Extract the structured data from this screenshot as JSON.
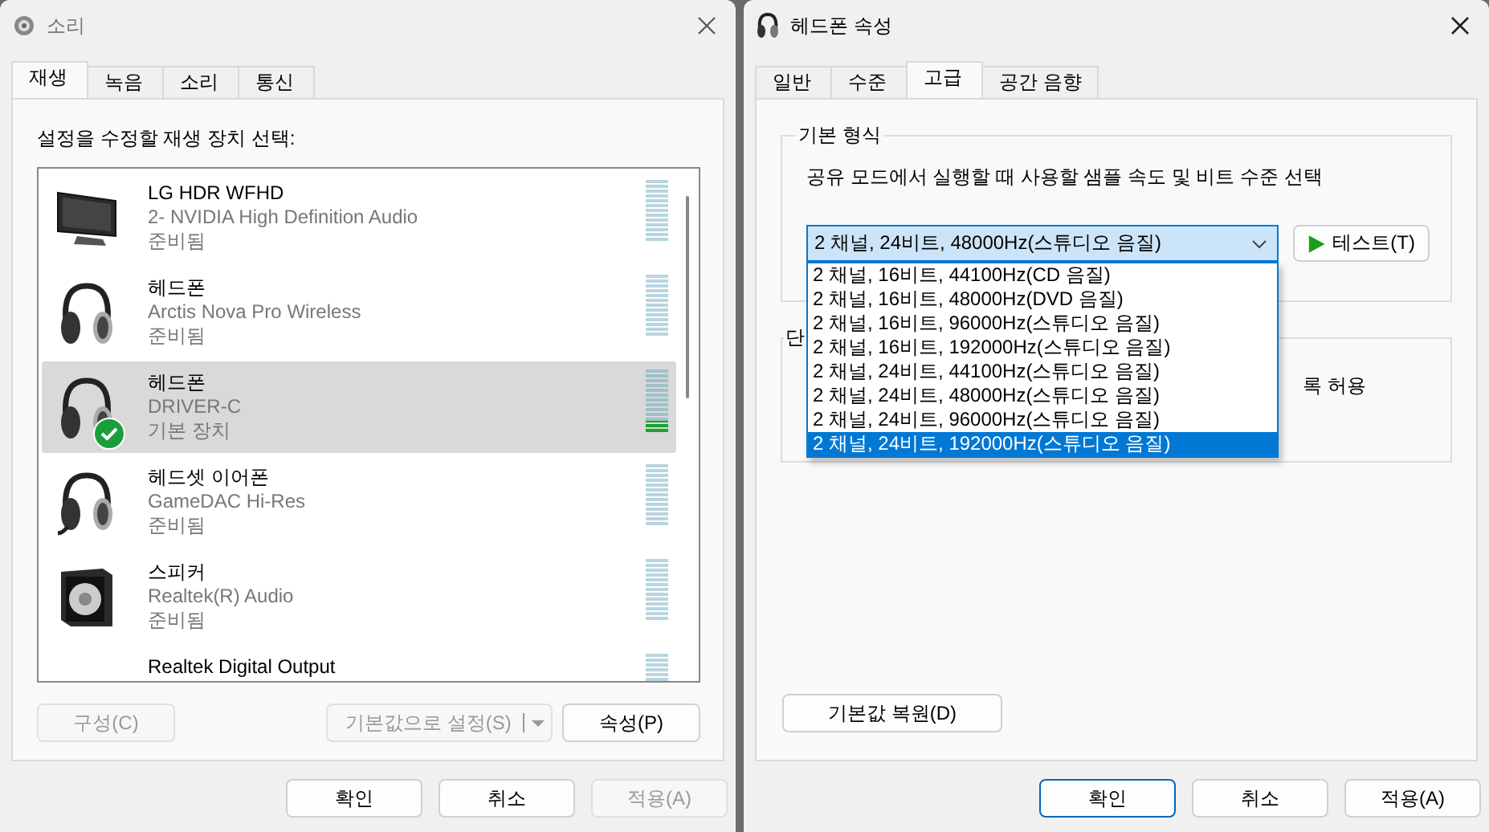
{
  "left_window": {
    "title": "소리",
    "tabs": [
      {
        "label": "재생",
        "selected": true
      },
      {
        "label": "녹음",
        "selected": false
      },
      {
        "label": "소리",
        "selected": false
      },
      {
        "label": "통신",
        "selected": false
      }
    ],
    "instruction": "설정을 수정할 재생 장치 선택:",
    "devices": [
      {
        "kind": "monitor",
        "name": "LG HDR WFHD",
        "description": "2- NVIDIA High Definition Audio",
        "status": "준비됨",
        "selected": false,
        "default": false,
        "level": 0
      },
      {
        "kind": "headphones",
        "name": "헤드폰",
        "description": "Arctis Nova Pro Wireless",
        "status": "준비됨",
        "selected": false,
        "default": false,
        "level": 0
      },
      {
        "kind": "headphones",
        "name": "헤드폰",
        "description": "DRIVER-C",
        "status": "기본 장치",
        "selected": true,
        "default": true,
        "level": 0.17
      },
      {
        "kind": "headset",
        "name": "헤드셋 이어폰",
        "description": "GameDAC Hi-Res",
        "status": "준비됨",
        "selected": false,
        "default": false,
        "level": 0
      },
      {
        "kind": "speaker",
        "name": "스피커",
        "description": "Realtek(R) Audio",
        "status": "준비됨",
        "selected": false,
        "default": false,
        "level": 0
      },
      {
        "kind": "none",
        "name": "Realtek Digital Output",
        "selected": false,
        "default": false,
        "level": 0
      }
    ],
    "buttons": [
      {
        "kind": "button",
        "label": "구성(C)",
        "disabled": true
      },
      {
        "kind": "split",
        "label": "기본값으로 설정(S)",
        "disabled": true
      },
      {
        "kind": "button",
        "label": "속성(P)",
        "disabled": false
      }
    ],
    "dialog_buttons": [
      {
        "label": "확인",
        "disabled": false,
        "focused": false
      },
      {
        "label": "취소",
        "disabled": false,
        "focused": false
      },
      {
        "label": "적용(A)",
        "disabled": true,
        "focused": false
      }
    ]
  },
  "right_window": {
    "title": "헤드폰 속성",
    "tabs": [
      {
        "label": "일반",
        "selected": false
      },
      {
        "label": "수준",
        "selected": false
      },
      {
        "label": "고급",
        "selected": true
      },
      {
        "label": "공간 음향",
        "selected": false
      }
    ],
    "format_group": {
      "title": "기본 형식",
      "description": "공유 모드에서 실행할 때 사용할 샘플 속도 및 비트 수준 선택",
      "combo_value": "2 채널, 24비트, 48000Hz(스튜디오 음질)",
      "test_button": "테스트(T)",
      "options": [
        {
          "label": "2 채널, 16비트, 44100Hz(CD 음질)",
          "selected": false
        },
        {
          "label": "2 채널, 16비트, 48000Hz(DVD 음질)",
          "selected": false
        },
        {
          "label": "2 채널, 16비트, 96000Hz(스튜디오 음질)",
          "selected": false
        },
        {
          "label": "2 채널, 16비트, 192000Hz(스튜디오 음질)",
          "selected": false
        },
        {
          "label": "2 채널, 24비트, 44100Hz(스튜디오 음질)",
          "selected": false
        },
        {
          "label": "2 채널, 24비트, 48000Hz(스튜디오 음질)",
          "selected": false
        },
        {
          "label": "2 채널, 24비트, 96000Hz(스튜디오 음질)",
          "selected": false
        },
        {
          "label": "2 채널, 24비트, 192000Hz(스튜디오 음질)",
          "selected": true
        }
      ]
    },
    "exclusive_group": {
      "title": "단",
      "text": "록 허용"
    },
    "restore_button": "기본값 복원(D)",
    "dialog_buttons": [
      {
        "label": "확인",
        "disabled": false,
        "focused": true
      },
      {
        "label": "취소",
        "disabled": false,
        "focused": false
      },
      {
        "label": "적용(A)",
        "disabled": false,
        "focused": false
      }
    ]
  }
}
